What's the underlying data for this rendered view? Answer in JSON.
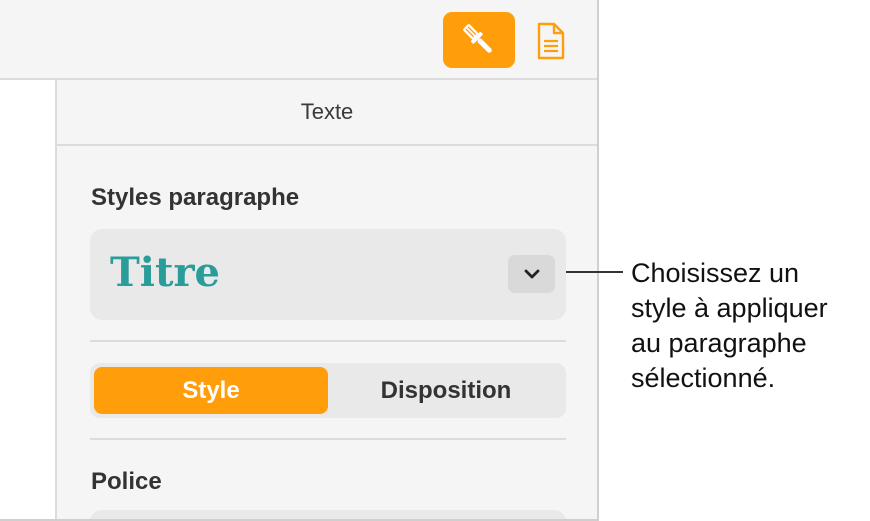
{
  "toolbar": {
    "format_button_icon": "paintbrush-icon",
    "document_button_icon": "document-icon",
    "accent_color": "#ff9d0a"
  },
  "sidebar": {
    "section_title": "Texte",
    "paragraph_styles_label": "Styles paragraphe",
    "selected_style": "Titre",
    "selected_style_color": "#2a9c9a",
    "tabs": [
      {
        "label": "Style",
        "selected": true
      },
      {
        "label": "Disposition",
        "selected": false
      }
    ],
    "font_label": "Police"
  },
  "callout": {
    "lines": [
      "Choisissez un",
      "style à appliquer",
      "au paragraphe",
      "sélectionné."
    ]
  }
}
